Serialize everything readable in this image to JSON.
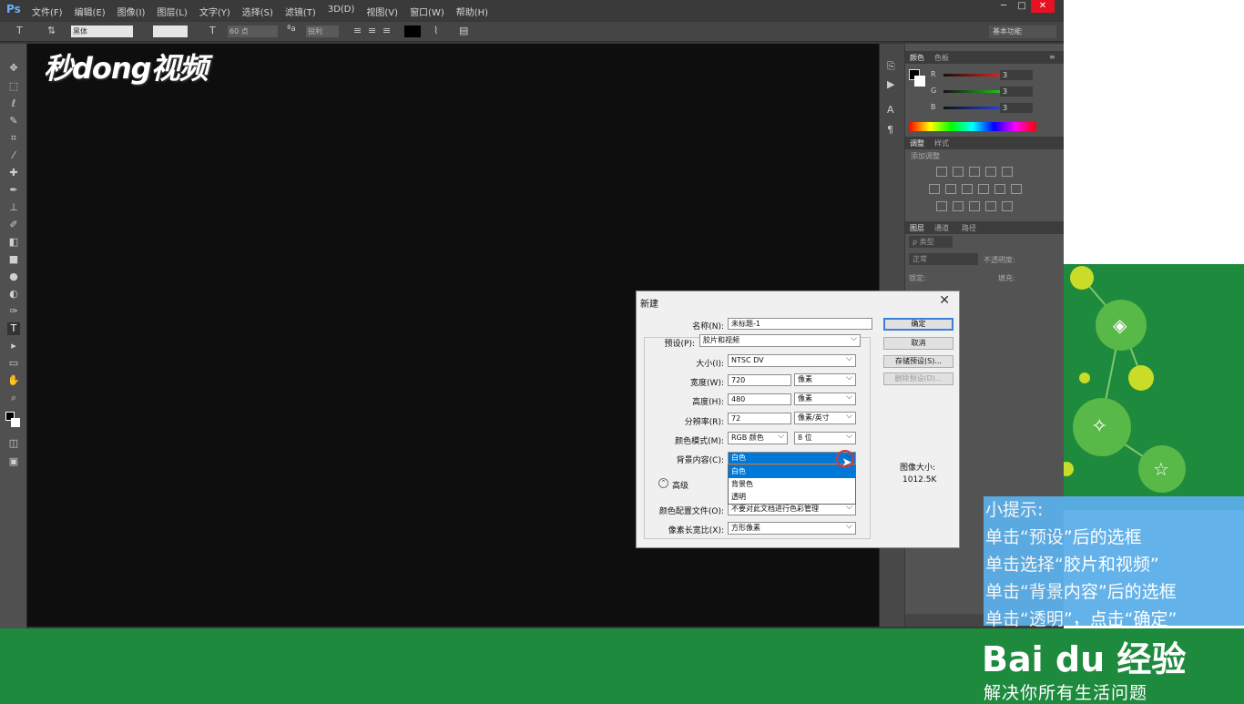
{
  "app": {
    "logo": "Ps",
    "menu": [
      "文件(F)",
      "编辑(E)",
      "图像(I)",
      "图层(L)",
      "文字(Y)",
      "选择(S)",
      "滤镜(T)",
      "3D(D)",
      "视图(V)",
      "窗口(W)",
      "帮助(H)"
    ],
    "window_buttons": {
      "minimize": "─",
      "maximize": "□",
      "close": "✕"
    }
  },
  "options_bar": {
    "font_family": "黑体",
    "font_size": "60 点",
    "antialias": "锐利",
    "workspace": "基本功能"
  },
  "watermark": "秒dong视频",
  "panels": {
    "color_tabs": [
      "颜色",
      "色板"
    ],
    "rgb": [
      {
        "label": "R",
        "value": "3",
        "color": "#e02020"
      },
      {
        "label": "G",
        "value": "3",
        "color": "#20c020"
      },
      {
        "label": "B",
        "value": "3",
        "color": "#2040e0"
      }
    ],
    "adjust_tabs": [
      "调整",
      "样式"
    ],
    "adjust_title": "添加调整",
    "layers_tabs": [
      "图层",
      "通道",
      "路径"
    ],
    "layers_kind": "ρ 类型",
    "blend_mode": "正常",
    "opacity_label": "不透明度:",
    "lock_label": "锁定:",
    "fill_label": "填充:"
  },
  "dialog": {
    "title": "新建",
    "name_label": "名称(N):",
    "name_value": "未标题-1",
    "preset_label": "预设(P):",
    "preset_value": "胶片和视频",
    "size_label": "大小(I):",
    "size_value": "NTSC DV",
    "width_label": "宽度(W):",
    "width_value": "720",
    "width_unit": "像素",
    "height_label": "高度(H):",
    "height_value": "480",
    "height_unit": "像素",
    "res_label": "分辨率(R):",
    "res_value": "72",
    "res_unit": "像素/英寸",
    "mode_label": "颜色模式(M):",
    "mode_value": "RGB 颜色",
    "bits_value": "8 位",
    "bg_label": "背景内容(C):",
    "bg_value": "白色",
    "bg_options": [
      "白色",
      "背景色",
      "透明"
    ],
    "advanced_label": "高级",
    "profile_label": "颜色配置文件(O):",
    "profile_value": "不要对此文档进行色彩管理",
    "aspect_label": "像素长宽比(X):",
    "aspect_value": "方形像素",
    "ok": "确定",
    "cancel": "取消",
    "save_preset": "存储预设(S)...",
    "delete_preset": "删除预设(D)...",
    "image_size_label": "图像大小:",
    "image_size_value": "1012.5K",
    "close": "✕"
  },
  "tip": {
    "title": "小提示:",
    "lines": [
      "单击“预设”后的选框",
      "单击选择“胶片和视频”",
      "单击“背景内容”后的选框",
      "单击“透明”，点击“确定”"
    ]
  },
  "brand": {
    "baidu": "Bai du 经验",
    "slogan": "解决你所有生活问题"
  }
}
